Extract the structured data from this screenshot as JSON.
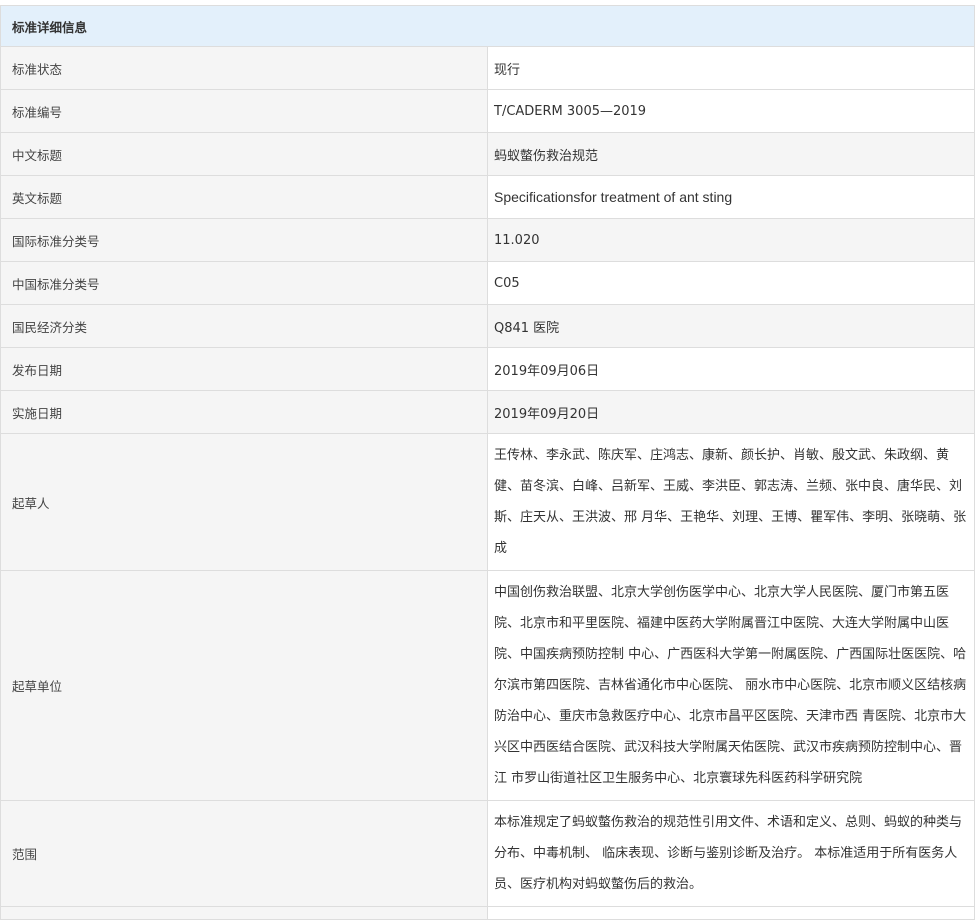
{
  "header": {
    "title": "标准详细信息"
  },
  "rows": [
    {
      "label": "标准状态",
      "value": "现行"
    },
    {
      "label": "标准编号",
      "value": "T/CADERM 3005—2019"
    },
    {
      "label": "中文标题",
      "value": "蚂蚁螫伤救治规范"
    },
    {
      "label": "英文标题",
      "value": "Specificationsfor treatment of ant sting"
    },
    {
      "label": "国际标准分类号",
      "value": "11.020"
    },
    {
      "label": "中国标准分类号",
      "value": "C05"
    },
    {
      "label": "国民经济分类",
      "value": "Q841 医院"
    },
    {
      "label": "发布日期",
      "value": "2019年09月06日"
    },
    {
      "label": "实施日期",
      "value": "2019年09月20日"
    },
    {
      "label": "起草人",
      "value": "王传林、李永武、陈庆军、庄鸿志、康新、颜长护、肖敏、殷文武、朱政纲、黄健、苗冬滨、白峰、吕新军、王威、李洪臣、郭志涛、兰频、张中良、唐华民、刘斯、庄天从、王洪波、邢 月华、王艳华、刘理、王博、瞿军伟、李明、张晓萌、张成"
    },
    {
      "label": "起草单位",
      "value": "中国创伤救治联盟、北京大学创伤医学中心、北京大学人民医院、厦门市第五医 院、北京市和平里医院、福建中医药大学附属晋江中医院、大连大学附属中山医院、中国疾病预防控制 中心、广西医科大学第一附属医院、广西国际壮医医院、哈尔滨市第四医院、吉林省通化市中心医院、 丽水市中心医院、北京市顺义区结核病防治中心、重庆市急救医疗中心、北京市昌平区医院、天津市西 青医院、北京市大兴区中西医结合医院、武汉科技大学附属天佑医院、武汉市疾病预防控制中心、晋江 市罗山街道社区卫生服务中心、北京寰球先科医药科学研究院"
    },
    {
      "label": "范围",
      "value": "本标准规定了蚂蚁螫伤救治的规范性引用文件、术语和定义、总则、蚂蚁的种类与分布、中毒机制、 临床表现、诊断与鉴别诊断及治疗。 本标准适用于所有医务人员、医疗机构对蚂蚁螫伤后的救治。"
    }
  ]
}
